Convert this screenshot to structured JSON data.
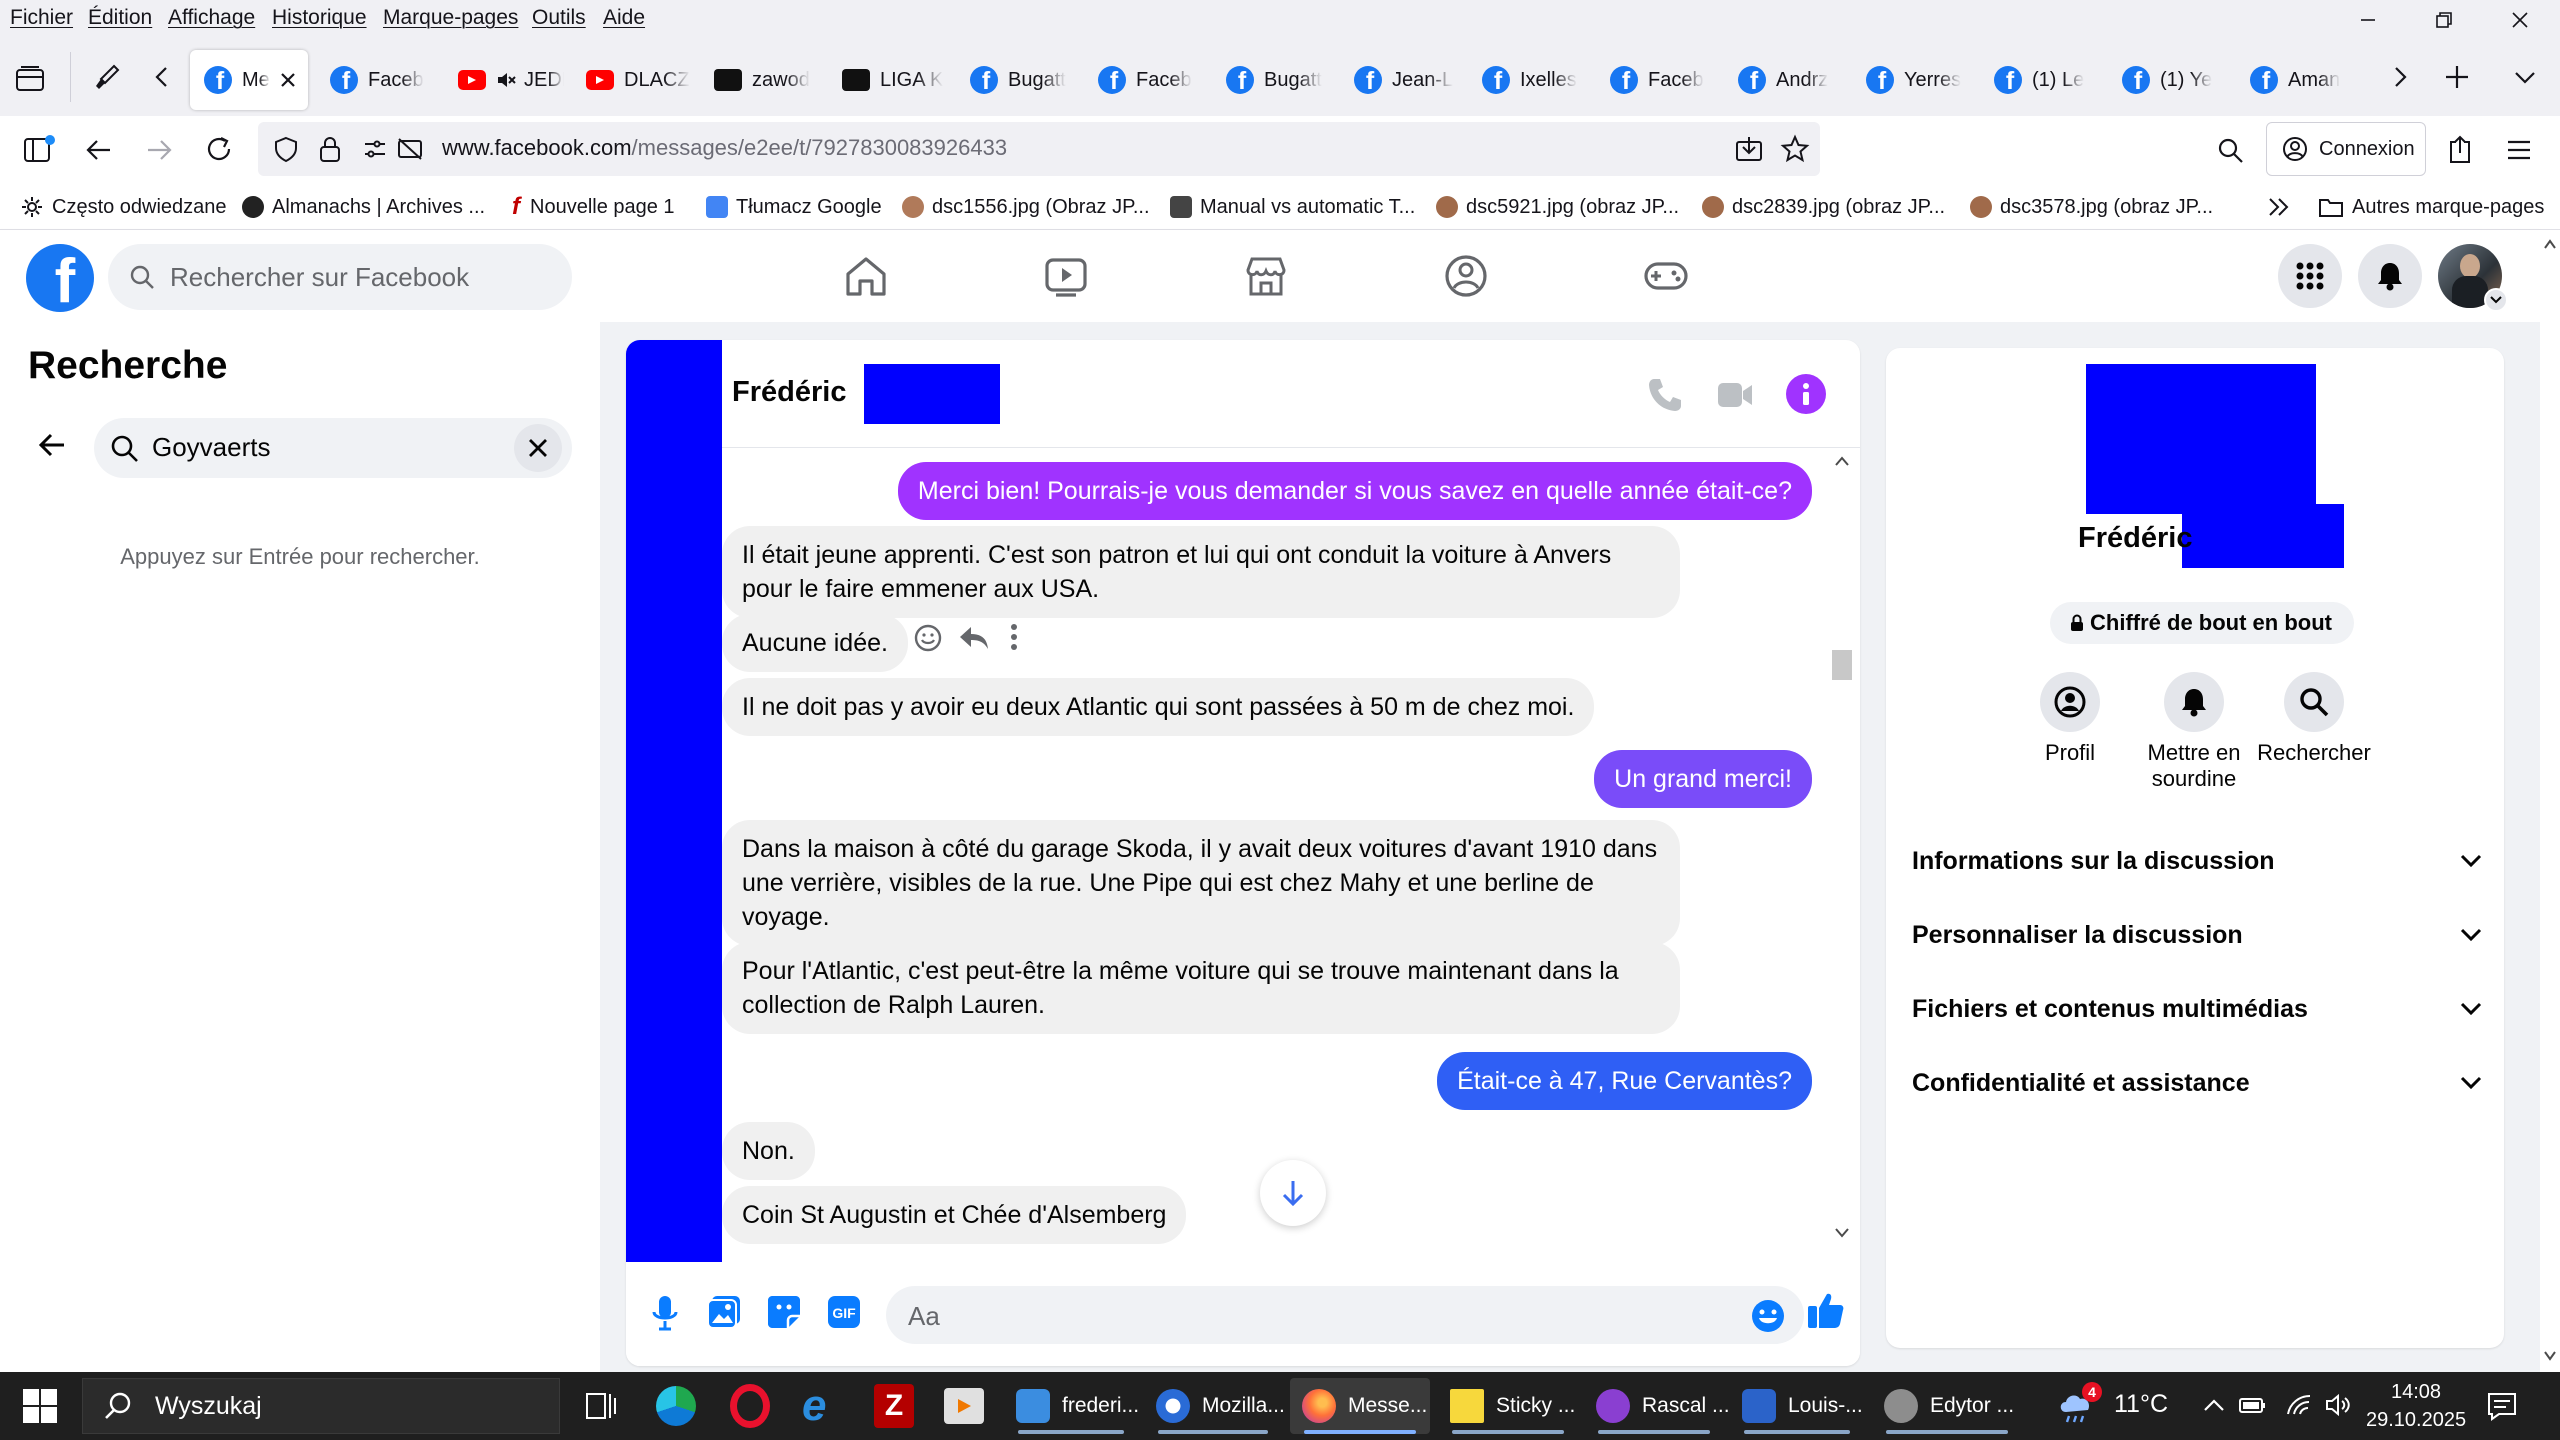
{
  "menubar": {
    "items": [
      "Fichier",
      "Édition",
      "Affichage",
      "Historique",
      "Marque-pages",
      "Outils",
      "Aide"
    ]
  },
  "tabs": [
    {
      "label": "Me",
      "icon": "facebook-icon",
      "active": true
    },
    {
      "label": "Faceb",
      "icon": "facebook-icon"
    },
    {
      "label": "JEDNA",
      "icon": "youtube-icon"
    },
    {
      "label": "DLACZ",
      "icon": "youtube-icon"
    },
    {
      "label": "zawod",
      "icon": "site-icon"
    },
    {
      "label": "LIGA K",
      "icon": "site-icon"
    },
    {
      "label": "Bugatt",
      "icon": "facebook-icon"
    },
    {
      "label": "Faceb",
      "icon": "facebook-icon"
    },
    {
      "label": "Bugatt",
      "icon": "facebook-icon"
    },
    {
      "label": "Jean-L",
      "icon": "facebook-icon"
    },
    {
      "label": "Ixelles",
      "icon": "facebook-icon"
    },
    {
      "label": "Faceb",
      "icon": "facebook-icon"
    },
    {
      "label": "Andrz",
      "icon": "facebook-icon"
    },
    {
      "label": "Yerres",
      "icon": "facebook-icon"
    },
    {
      "label": "(1) Le",
      "icon": "facebook-icon"
    },
    {
      "label": "(1) Ye",
      "icon": "facebook-icon"
    },
    {
      "label": "Aman",
      "icon": "facebook-icon"
    }
  ],
  "urlbar": {
    "domain": "www.facebook.com",
    "path": "/messages/e2ee/t/7927830083926433",
    "connexion_label": "Connexion"
  },
  "bookmarks": {
    "items": [
      "Często odwiedzane",
      "Almanachs | Archives ...",
      "Nouvelle page 1",
      "Tłumacz Google",
      "dsc1556.jpg (Obraz JP...",
      "Manual vs automatic T...",
      "dsc5921.jpg (obraz JP...",
      "dsc2839.jpg (obraz JP...",
      "dsc3578.jpg (obraz JP..."
    ],
    "other_label": "Autres marque-pages"
  },
  "facebook": {
    "search_placeholder": "Rechercher sur Facebook"
  },
  "sidebar": {
    "title": "Recherche",
    "search_value": "Goyvaerts",
    "hint": "Appuyez sur Entrée pour rechercher."
  },
  "chat": {
    "contact_name": "Frédéric",
    "messages": [
      {
        "dir": "out",
        "text": "Merci bien! Pourrais-je vous demander si vous savez en quelle année était-ce?"
      },
      {
        "dir": "in",
        "text": "Il était jeune apprenti. C'est son patron et lui qui ont conduit la voiture à Anvers pour le faire emmener aux USA."
      },
      {
        "dir": "in",
        "text": "Aucune idée."
      },
      {
        "dir": "in",
        "text": "Il ne doit pas y avoir eu deux Atlantic qui sont passées à 50 m de chez moi."
      },
      {
        "dir": "out",
        "text": "Un grand merci!"
      },
      {
        "dir": "in",
        "text": "Dans la maison à côté du garage Skoda, il y avait deux voitures d'avant 1910 dans une verrière, visibles de la rue. Une Pipe qui est chez Mahy et une berline de voyage."
      },
      {
        "dir": "in",
        "text": "Pour l'Atlantic, c'est peut-être la même voiture qui se trouve maintenant dans la collection de Ralph Lauren."
      },
      {
        "dir": "out",
        "text": "Était-ce à 47, Rue Cervantès?"
      },
      {
        "dir": "in",
        "text": "Non."
      },
      {
        "dir": "in",
        "text": "Coin St Augustin et Chée d'Alsemberg"
      }
    ],
    "composer_placeholder": "Aa"
  },
  "details": {
    "name": "Frédéric",
    "encryption_label": "Chiffré de bout en bout",
    "actions": [
      "Profil",
      "Mettre en sourdine",
      "Rechercher"
    ],
    "sections": [
      "Informations sur la discussion",
      "Personnaliser la discussion",
      "Fichiers et contenus multimédias",
      "Confidentialité et assistance"
    ]
  },
  "taskbar": {
    "search_label": "Wyszukaj",
    "apps": [
      "frederi...",
      "Mozilla...",
      "Messe...",
      "Sticky ...",
      "Rascal ...",
      "Louis-...",
      "Edytor ..."
    ],
    "temperature": "11°C",
    "time": "14:08",
    "date": "29.10.2025",
    "notification_count": "4"
  },
  "colors": {
    "facebook_blue": "#1877f2",
    "redaction_blue": "#0000ff",
    "bubble_gradient_top": "#a033ff",
    "bubble_gradient_bottom": "#0a7cff",
    "messenger_purple": "#a033ff"
  }
}
